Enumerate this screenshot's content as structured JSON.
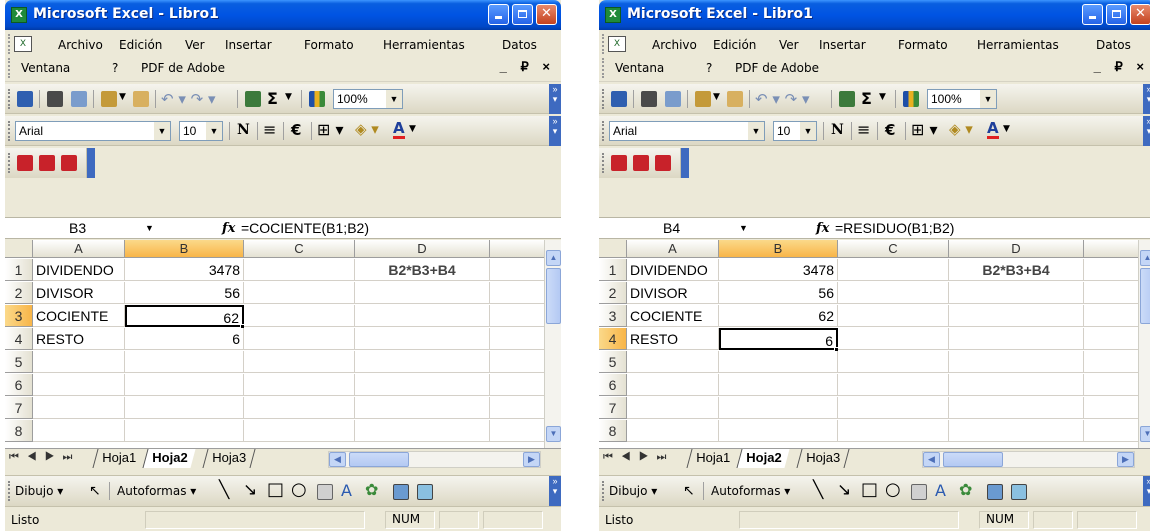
{
  "app": {
    "title": "Microsoft Excel - Libro1",
    "icon_letter": "X"
  },
  "menu": {
    "items": [
      "Archivo",
      "Edición",
      "Ver",
      "Insertar",
      "Formato",
      "Herramientas",
      "Datos",
      "Ventana",
      "?",
      "PDF de Adobe"
    ],
    "doc_controls": "_ ₽ ×"
  },
  "toolbar": {
    "zoom": "100%",
    "font_name": "Arial",
    "font_size": "10",
    "bold": "N",
    "euro": "€",
    "sigma": "Σ",
    "font_color_letter": "A"
  },
  "sheet": {
    "columns": [
      "A",
      "B",
      "C",
      "D"
    ],
    "row_numbers": [
      "1",
      "2",
      "3",
      "4",
      "5",
      "6",
      "7",
      "8"
    ],
    "labels": [
      "DIVIDENDO",
      "DIVISOR",
      "COCIENTE",
      "RESTO"
    ],
    "values": [
      "3478",
      "56",
      "62",
      "6"
    ],
    "note": "B2*B3+B4",
    "tabs": [
      "Hoja1",
      "Hoja2",
      "Hoja3"
    ],
    "active_tab": "Hoja2"
  },
  "windows": [
    {
      "namebox": "B3",
      "formula": "=COCIENTE(B1;B2)",
      "active_row": 3
    },
    {
      "namebox": "B4",
      "formula": "=RESIDUO(B1;B2)",
      "active_row": 4
    }
  ],
  "drawbar": {
    "dibujo": "Dibujo",
    "autoformas": "Autoformas"
  },
  "status": {
    "ready": "Listo",
    "num": "NUM"
  },
  "colors": {
    "title_blue": "#0054e3",
    "selection_orange": "#f8b548",
    "window_bg": "#ece9d8"
  }
}
